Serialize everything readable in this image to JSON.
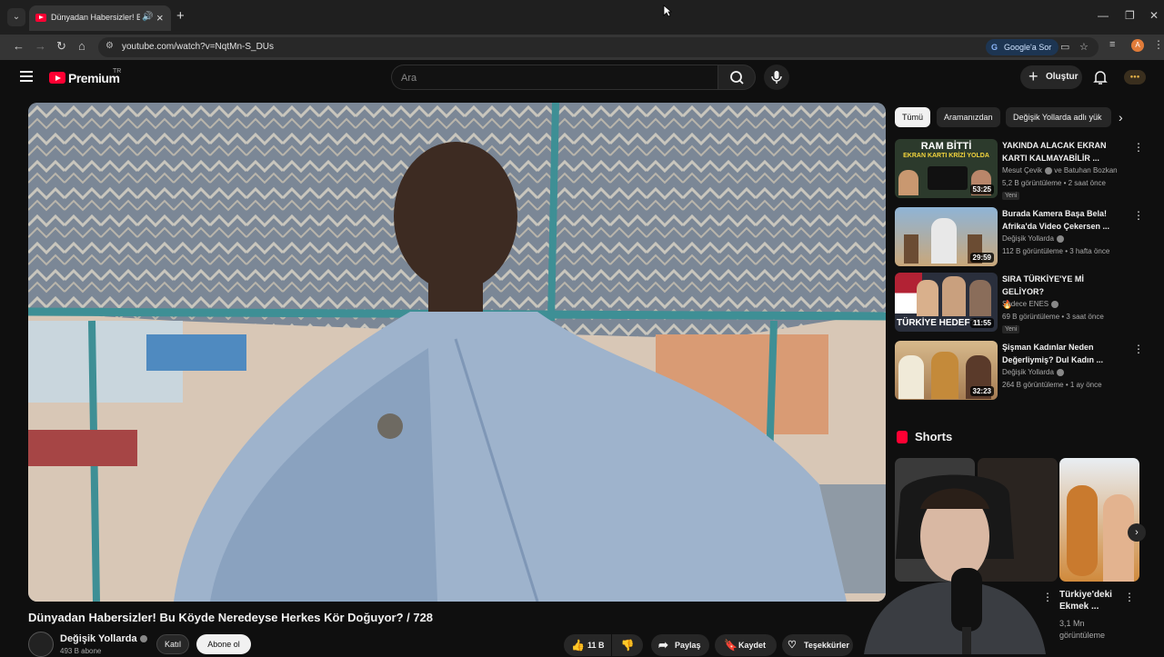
{
  "browser": {
    "tab_title": "Dünyadan Habersizler! Bu K",
    "url": "youtube.com/watch?v=NqtMn-S_DUs",
    "ask_google": "Google'a Sor",
    "profile_initial": "A"
  },
  "header": {
    "logo_text": "Premium",
    "region": "TR",
    "search_placeholder": "Ara",
    "create_label": "Oluştur"
  },
  "video": {
    "title": "Dünyadan Habersizler! Bu Köyde Neredeyse Herkes Kör Doğuyor? / 728",
    "channel": "Değişik Yollarda",
    "subscribers": "493 B abone",
    "join_label": "Katıl",
    "subscribe_label": "Abone ol",
    "likes": "11 B",
    "share_label": "Paylaş",
    "save_label": "Kaydet",
    "thanks_label": "Teşekkürler"
  },
  "chips": [
    "Tümü",
    "Aramanızdan",
    "Değişik Yollarda adlı yük"
  ],
  "recommendations": [
    {
      "title": "YAKINDA ALACAK EKRAN KARTI KALMAYABİLİR ...",
      "channel": "Mesut Çevik",
      "channel_extra": "ve Batuhan Bozkan",
      "meta": "5,2 B görüntüleme • 2 saat önce",
      "badge": "Yeni",
      "duration": "53:25",
      "thumb_text_1": "RAM BİTTİ",
      "thumb_text_2": "EKRAN KARTI KRİZİ YOLDA"
    },
    {
      "title": "Burada Kamera Başa Bela! Afrika'da Video Çekersen ...",
      "channel": "Değişik Yollarda",
      "channel_extra": "",
      "meta": "112 B görüntüleme • 3 hafta önce",
      "badge": "",
      "duration": "29:59"
    },
    {
      "title": "SIRA TÜRKİYE'YE Mİ GELİYOR?",
      "title_extra": "🔥",
      "channel": "Sadece ENES",
      "channel_extra": "",
      "meta": "69 B görüntüleme • 3 saat önce",
      "badge": "Yeni",
      "duration": "11:55",
      "thumb_text_1": "TÜRKİYE HEDEF?E"
    },
    {
      "title": "Şişman Kadınlar Neden Değerliymiş? Dul Kadın ...",
      "channel": "Değişik Yollarda",
      "channel_extra": "",
      "meta": "264 B görüntüleme • 1 ay önce",
      "badge": "",
      "duration": "32:23"
    }
  ],
  "shorts": {
    "section_title": "Shorts",
    "items": [
      {
        "title": "Türkiye'deki Ekmek ...",
        "views": "3,1 Mn görüntüleme"
      }
    ]
  }
}
